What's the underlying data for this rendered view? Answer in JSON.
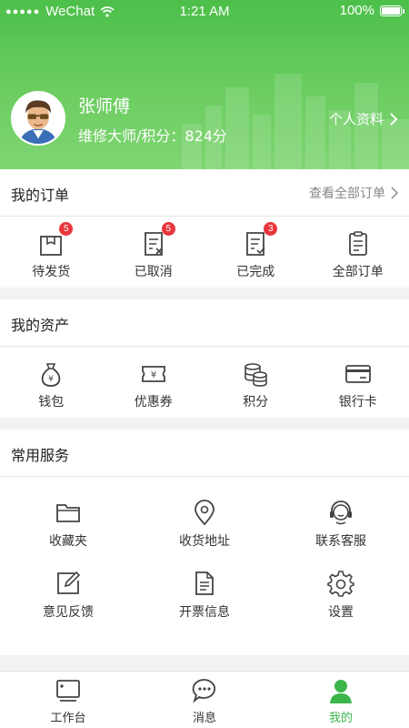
{
  "status_bar": {
    "carrier": "WeChat",
    "signal_dots": "●●●●●",
    "time": "1:21 AM",
    "battery": "100%"
  },
  "profile": {
    "name": "张师傅",
    "meta": "维修大师/积分：824分",
    "link_label": "个人资料"
  },
  "orders": {
    "title": "我的订单",
    "view_all": "查看全部订单",
    "items": [
      {
        "label": "待发货",
        "badge": "5",
        "icon": "package-icon"
      },
      {
        "label": "已取消",
        "badge": "5",
        "icon": "order-cancelled-icon"
      },
      {
        "label": "已完成",
        "badge": "3",
        "icon": "order-completed-icon"
      },
      {
        "label": "全部订单",
        "icon": "clipboard-icon"
      }
    ]
  },
  "assets": {
    "title": "我的资产",
    "items": [
      {
        "label": "钱包",
        "icon": "money-bag-icon"
      },
      {
        "label": "优惠券",
        "icon": "coupon-icon"
      },
      {
        "label": "积分",
        "icon": "coins-icon"
      },
      {
        "label": "银行卡",
        "icon": "bank-card-icon"
      }
    ]
  },
  "services": {
    "title": "常用服务",
    "items": [
      {
        "label": "收藏夹",
        "icon": "folder-icon"
      },
      {
        "label": "收货地址",
        "icon": "location-pin-icon"
      },
      {
        "label": "联系客服",
        "icon": "customer-service-icon"
      },
      {
        "label": "意见反馈",
        "icon": "edit-icon"
      },
      {
        "label": "开票信息",
        "icon": "document-icon"
      },
      {
        "label": "设置",
        "icon": "gear-icon"
      }
    ]
  },
  "tabbar": {
    "items": [
      {
        "label": "工作台",
        "icon": "workbench-icon"
      },
      {
        "label": "消息",
        "icon": "message-icon"
      },
      {
        "label": "我的",
        "icon": "user-icon",
        "active": true
      }
    ]
  },
  "colors": {
    "brand_green": "#4cc04a",
    "active_green": "#3bb54a",
    "badge_red": "#e8363c"
  }
}
